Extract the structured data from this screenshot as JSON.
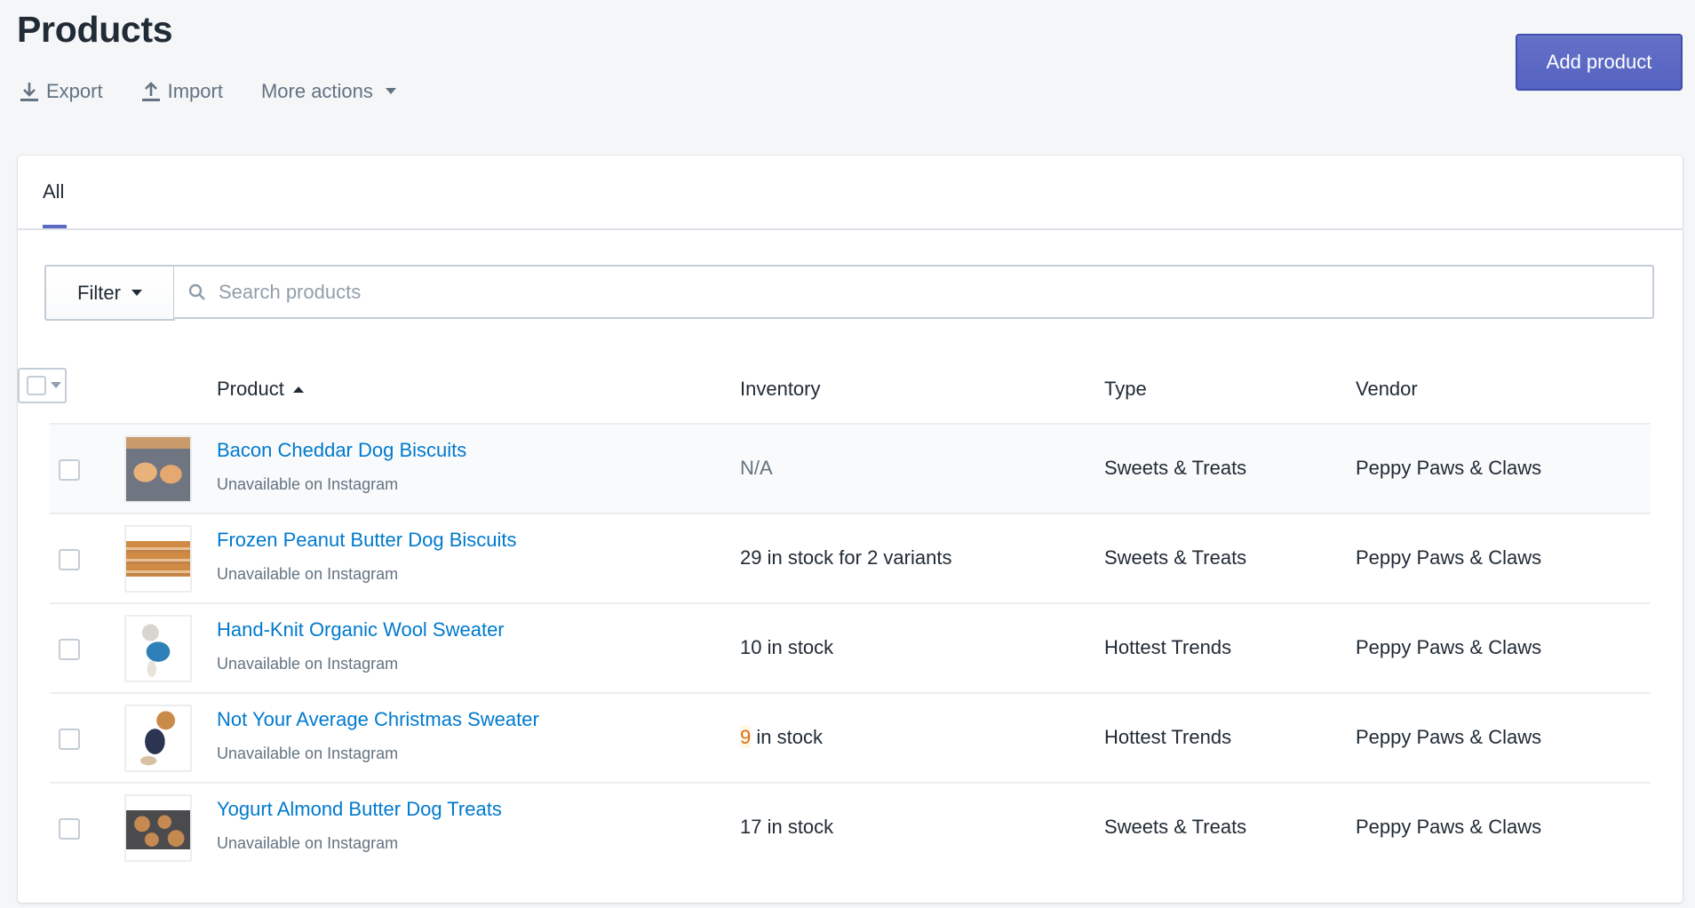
{
  "header": {
    "title": "Products",
    "actions": [
      {
        "label": "Export",
        "icon": "export-icon"
      },
      {
        "label": "Import",
        "icon": "import-icon"
      },
      {
        "label": "More actions",
        "icon": "caret-down-icon"
      }
    ],
    "primary_button": "Add product"
  },
  "tabs": [
    {
      "label": "All",
      "active": true
    }
  ],
  "filter": {
    "button_label": "Filter",
    "search_placeholder": "Search products",
    "search_value": ""
  },
  "table": {
    "columns": {
      "product": "Product",
      "inventory": "Inventory",
      "type": "Type",
      "vendor": "Vendor"
    },
    "sort": {
      "column": "Product",
      "direction": "ascending"
    },
    "rows": [
      {
        "name": "Bacon Cheddar Dog Biscuits",
        "availability": "Unavailable on Instagram",
        "inventory": "N/A",
        "inventory_count": "",
        "inventory_suffix": "",
        "type": "Sweets & Treats",
        "vendor": "Peppy Paws & Claws",
        "thumbnail": "dog-biscuit-bone-photo"
      },
      {
        "name": "Frozen Peanut Butter Dog Biscuits",
        "availability": "Unavailable on Instagram",
        "inventory": "29 in stock for 2 variants",
        "type": "Sweets & Treats",
        "vendor": "Peppy Paws & Claws",
        "thumbnail": "peanut-butter-biscuits-photo"
      },
      {
        "name": "Hand-Knit Organic Wool Sweater",
        "availability": "Unavailable on Instagram",
        "inventory": "10 in stock",
        "type": "Hottest Trends",
        "vendor": "Peppy Paws & Claws",
        "thumbnail": "chihuahua-sweater-photo"
      },
      {
        "name": "Not Your Average Christmas Sweater",
        "availability": "Unavailable on Instagram",
        "inventory_count": "9",
        "inventory_suffix": " in stock",
        "inventory_low": true,
        "type": "Hottest Trends",
        "vendor": "Peppy Paws & Claws",
        "thumbnail": "beagle-christmas-sweater-photo"
      },
      {
        "name": "Yogurt Almond Butter Dog Treats",
        "availability": "Unavailable on Instagram",
        "inventory": "17 in stock",
        "type": "Sweets & Treats",
        "vendor": "Peppy Paws & Claws",
        "thumbnail": "paw-shaped-treats-photo"
      }
    ]
  },
  "colors": {
    "accent": "#5c6ac4",
    "link": "#007ace",
    "low_stock": "#de6c1d",
    "background": "#f4f6f8"
  }
}
